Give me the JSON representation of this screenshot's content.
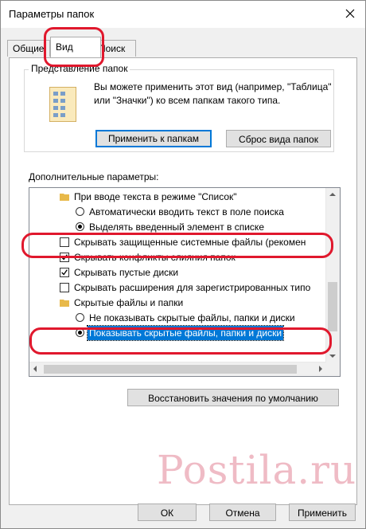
{
  "window": {
    "title": "Параметры папок"
  },
  "tabs": [
    {
      "label": "Общие"
    },
    {
      "label": "Вид"
    },
    {
      "label": "Поиск"
    }
  ],
  "folder_views": {
    "legend": "Представление папок",
    "description": "Вы можете применить этот вид (например, \"Таблица\" или \"Значки\") ко всем папкам такого типа.",
    "apply_button": "Применить к папкам",
    "reset_button": "Сброс вида папок"
  },
  "advanced": {
    "legend": "Дополнительные параметры:",
    "items": [
      {
        "type": "folder",
        "text": "При вводе текста в режиме \"Список\""
      },
      {
        "type": "radio",
        "checked": false,
        "text": "Автоматически вводить текст в поле поиска"
      },
      {
        "type": "radio",
        "checked": true,
        "text": "Выделять введенный элемент в списке"
      },
      {
        "type": "checkbox",
        "checked": false,
        "text": "Скрывать защищенные системные файлы (рекомен"
      },
      {
        "type": "checkbox",
        "checked": true,
        "text": "Скрывать конфликты слияния папок"
      },
      {
        "type": "checkbox",
        "checked": true,
        "text": "Скрывать пустые диски"
      },
      {
        "type": "checkbox",
        "checked": false,
        "text": "Скрывать расширения для зарегистрированных типо"
      },
      {
        "type": "folder",
        "text": "Скрытые файлы и папки"
      },
      {
        "type": "radio",
        "checked": false,
        "text": "Не показывать скрытые файлы, папки и диски"
      },
      {
        "type": "radio",
        "checked": true,
        "selected": true,
        "text": "Показывать скрытые файлы, папки и диски"
      }
    ],
    "restore_button": "Восстановить значения по умолчанию"
  },
  "buttons": {
    "ok": "ОК",
    "cancel": "Отмена",
    "apply": "Применить"
  },
  "watermark": "Postila.ru",
  "colors": {
    "highlight": "#e0182d",
    "selection": "#0078d7",
    "focus_border": "#0078d7"
  }
}
